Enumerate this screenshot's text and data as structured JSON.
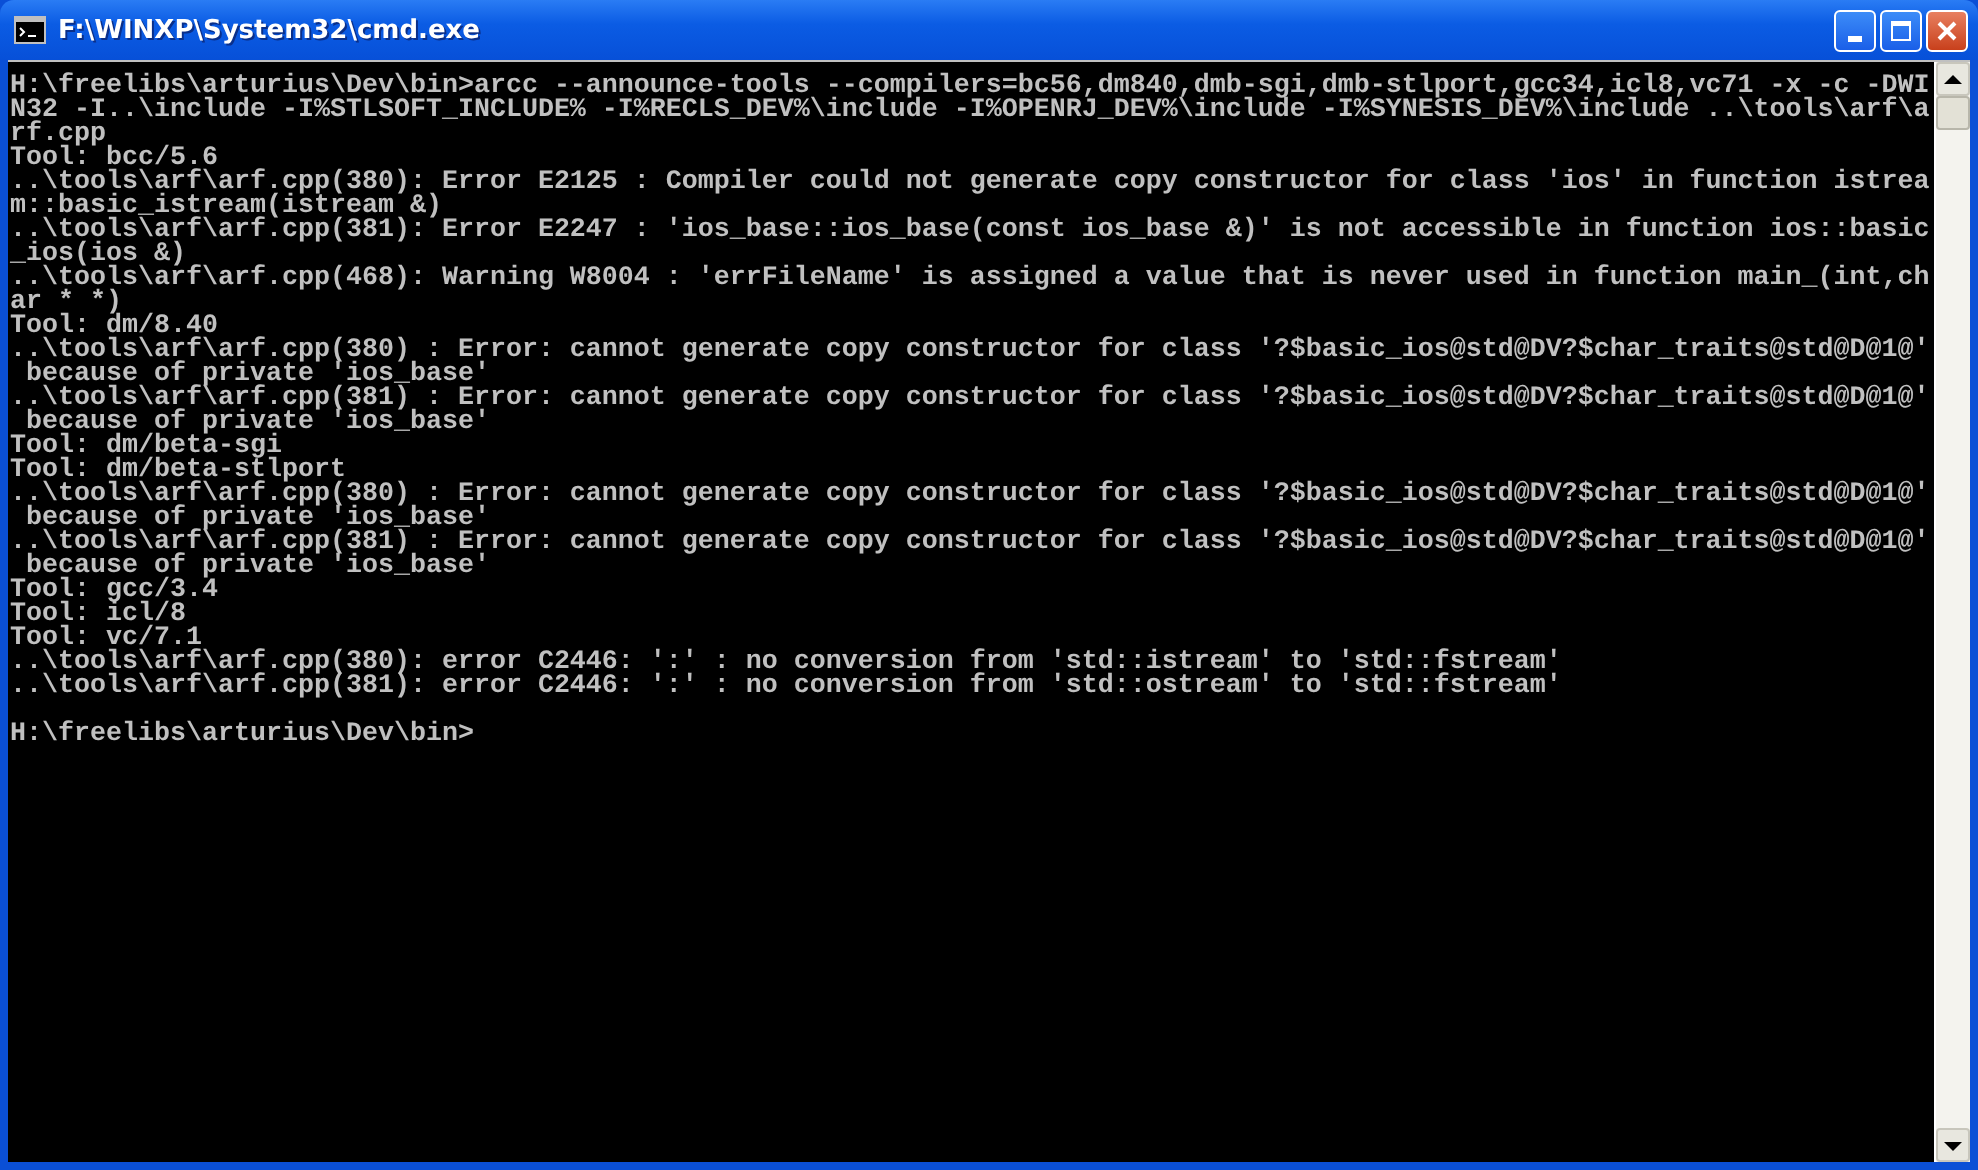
{
  "window": {
    "title": "F:\\WINXP\\System32\\cmd.exe"
  },
  "console": {
    "lines": [
      "H:\\freelibs\\arturius\\Dev\\bin>arcc --announce-tools --compilers=bc56,dm840,dmb-sgi,dmb-stlport,gcc34,icl8,vc71 -x -c -DWI",
      "N32 -I..\\include -I%STLSOFT_INCLUDE% -I%RECLS_DEV%\\include -I%OPENRJ_DEV%\\include -I%SYNESIS_DEV%\\include ..\\tools\\arf\\a",
      "rf.cpp",
      "Tool: bcc/5.6",
      "..\\tools\\arf\\arf.cpp(380): Error E2125 : Compiler could not generate copy constructor for class 'ios' in function istrea",
      "m::basic_istream(istream &)",
      "..\\tools\\arf\\arf.cpp(381): Error E2247 : 'ios_base::ios_base(const ios_base &)' is not accessible in function ios::basic",
      "_ios(ios &)",
      "..\\tools\\arf\\arf.cpp(468): Warning W8004 : 'errFileName' is assigned a value that is never used in function main_(int,ch",
      "ar * *)",
      "Tool: dm/8.40",
      "..\\tools\\arf\\arf.cpp(380) : Error: cannot generate copy constructor for class '?$basic_ios@std@DV?$char_traits@std@D@1@'",
      " because of private 'ios_base'",
      "..\\tools\\arf\\arf.cpp(381) : Error: cannot generate copy constructor for class '?$basic_ios@std@DV?$char_traits@std@D@1@'",
      " because of private 'ios_base'",
      "Tool: dm/beta-sgi",
      "Tool: dm/beta-stlport",
      "..\\tools\\arf\\arf.cpp(380) : Error: cannot generate copy constructor for class '?$basic_ios@std@DV?$char_traits@std@D@1@'",
      " because of private 'ios_base'",
      "..\\tools\\arf\\arf.cpp(381) : Error: cannot generate copy constructor for class '?$basic_ios@std@DV?$char_traits@std@D@1@'",
      " because of private 'ios_base'",
      "Tool: gcc/3.4",
      "Tool: icl/8",
      "Tool: vc/7.1",
      "..\\tools\\arf\\arf.cpp(380): error C2446: ':' : no conversion from 'std::istream' to 'std::fstream'",
      "..\\tools\\arf\\arf.cpp(381): error C2446: ':' : no conversion from 'std::ostream' to 'std::fstream'"
    ],
    "prompt": "H:\\freelibs\\arturius\\Dev\\bin>"
  }
}
